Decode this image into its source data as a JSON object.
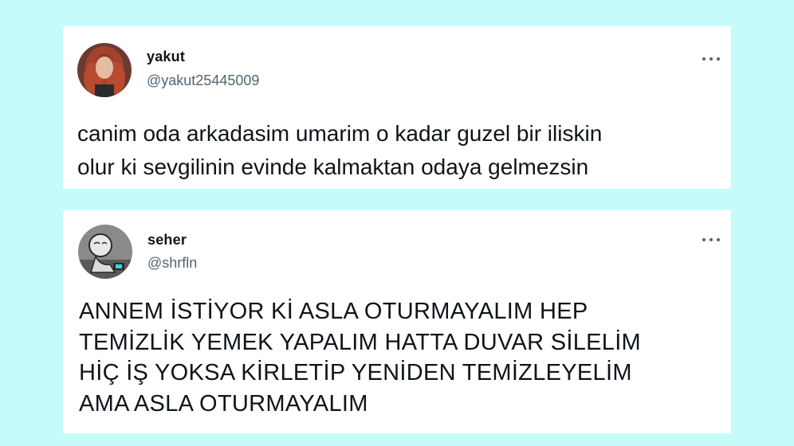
{
  "tweets": [
    {
      "display_name": "yakut",
      "handle": "@yakut25445009",
      "lines": [
        "canim oda arkadasim umarim o kadar guzel bir iliskin",
        "olur ki sevgilinin evinde kalmaktan odaya gelmezsin"
      ],
      "more_icon": "more-horizontal-icon"
    },
    {
      "display_name": "seher",
      "handle": "@shrfln",
      "lines": [
        "ANNEM İSTİYOR Kİ ASLA OTURMAYALIM HEP",
        "TEMİZLİK YEMEK YAPALIM HATTA DUVAR SİLELİM",
        "HİÇ İŞ YOKSA KİRLETİP YENİDEN TEMİZLEYELİM",
        "AMA ASLA OTURMAYALIM"
      ],
      "more_icon": "more-horizontal-icon"
    }
  ],
  "colors": {
    "background": "#c5fbf9",
    "card": "#ffffff",
    "text_primary": "#0f1419",
    "text_secondary": "#536471"
  }
}
